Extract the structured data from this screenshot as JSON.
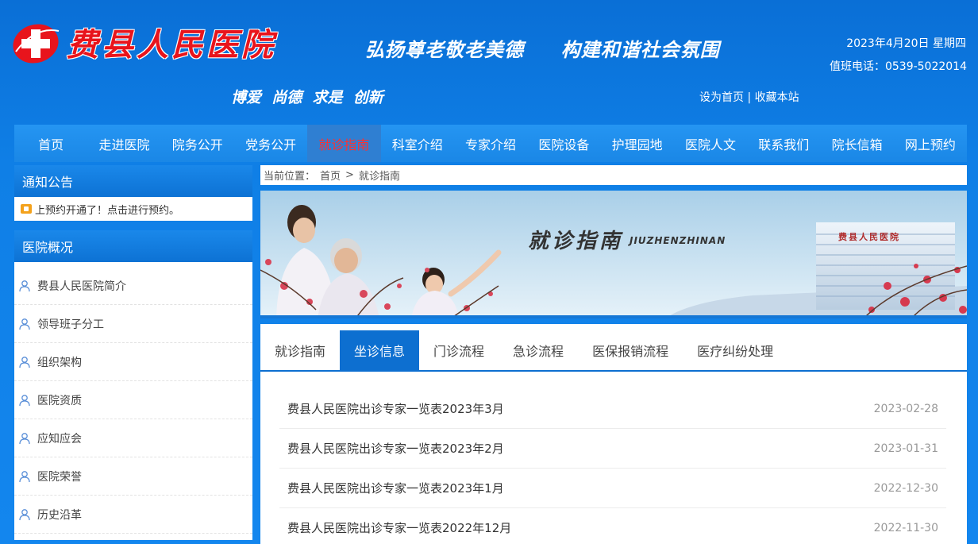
{
  "header": {
    "hospital_name": "费县人民医院",
    "slogan_main": "弘扬尊老敬老美德     构建和谐社会氛围",
    "slogan_sub": "博爱  尚德  求是  创新",
    "date": "2023年4月20日 星期四",
    "duty_phone": "值班电话：0539-5022014",
    "set_home": "设为首页",
    "separator": "|",
    "bookmark": "收藏本站"
  },
  "nav": [
    "首页",
    "走进医院",
    "院务公开",
    "党务公开",
    "就诊指南",
    "科室介绍",
    "专家介绍",
    "医院设备",
    "护理园地",
    "医院人文",
    "联系我们",
    "院长信箱",
    "网上预约"
  ],
  "nav_active": "就诊指南",
  "left": {
    "notice_title": "通知公告",
    "notice_text": "上预约开通了！点击进行预约。",
    "overview_title": "医院概况",
    "overview_items": [
      "费县人民医院简介",
      "领导班子分工",
      "组织架构",
      "医院资质",
      "应知应会",
      "医院荣誉",
      "历史沿革"
    ]
  },
  "breadcrumb": {
    "label": "当前位置：",
    "home": "首页",
    "sep": ">",
    "current": "就诊指南"
  },
  "banner": {
    "title": "就诊指南",
    "subtitle": "JIUZHENZHINAN",
    "building_text": "费县人民医院"
  },
  "tabs": [
    "就诊指南",
    "坐诊信息",
    "门诊流程",
    "急诊流程",
    "医保报销流程",
    "医疗纠纷处理"
  ],
  "tab_active": "坐诊信息",
  "list": [
    {
      "title": "费县人民医院出诊专家一览表2023年3月",
      "date": "2023-02-28"
    },
    {
      "title": "费县人民医院出诊专家一览表2023年2月",
      "date": "2023-01-31"
    },
    {
      "title": "费县人民医院出诊专家一览表2023年1月",
      "date": "2022-12-30"
    },
    {
      "title": "费县人民医院出诊专家一览表2022年12月",
      "date": "2022-11-30"
    }
  ],
  "colors": {
    "primary": "#0d6fd0",
    "nav_active_text": "#ff3030",
    "logo_red": "#e8141c"
  }
}
